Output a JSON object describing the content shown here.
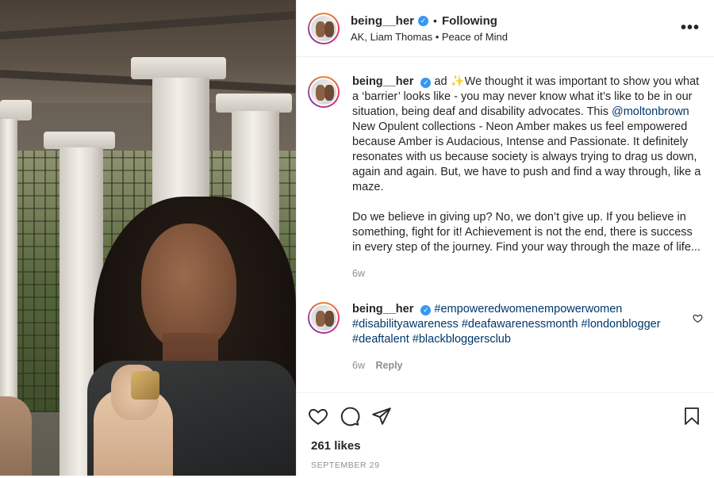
{
  "header": {
    "username": "being__her",
    "separator": "•",
    "follow_state": "Following",
    "subtitle": "AK, Liam Thomas • Peace of Mind",
    "more_label": "•••"
  },
  "caption": {
    "username": "being__her",
    "ad_label": "ad",
    "sparkle": "✨",
    "text_before_mention": "We thought it was important to show you what a ‘barrier’ looks like - you may never know what it’s like to be in our situation, being deaf and disability advocates. This ",
    "mention": "@moltonbrown",
    "text_after_mention": " New Opulent collections - Neon Amber makes us feel empowered because Amber is Audacious, Intense and Passionate. It definitely resonates with us because society is always trying to drag us down, again and again. But, we have to push and find a way through, like a maze.",
    "paragraph2": "Do we believe in giving up? No, we don’t give up. If you believe in something, fight for it! Achievement is not the end, there is success in every step of the journey. Find your way through the maze of life...",
    "time": "6w"
  },
  "comment": {
    "username": "being__her",
    "hashtags": "#empoweredwomenempowerwomen #disabilityawareness #deafawarenessmonth #londonblogger #deaftalent #blackbloggersclub",
    "time": "6w",
    "reply_label": "Reply"
  },
  "footer": {
    "likes": "261 likes",
    "date": "SEPTEMBER 29"
  },
  "colors": {
    "verified": "#3897f0",
    "link": "#00376b",
    "muted": "#8e8e8e",
    "text": "#262626"
  },
  "icons": [
    "verified-badge-icon",
    "more-options-icon",
    "heart-icon",
    "comment-icon",
    "share-icon",
    "bookmark-icon",
    "like-comment-icon"
  ]
}
